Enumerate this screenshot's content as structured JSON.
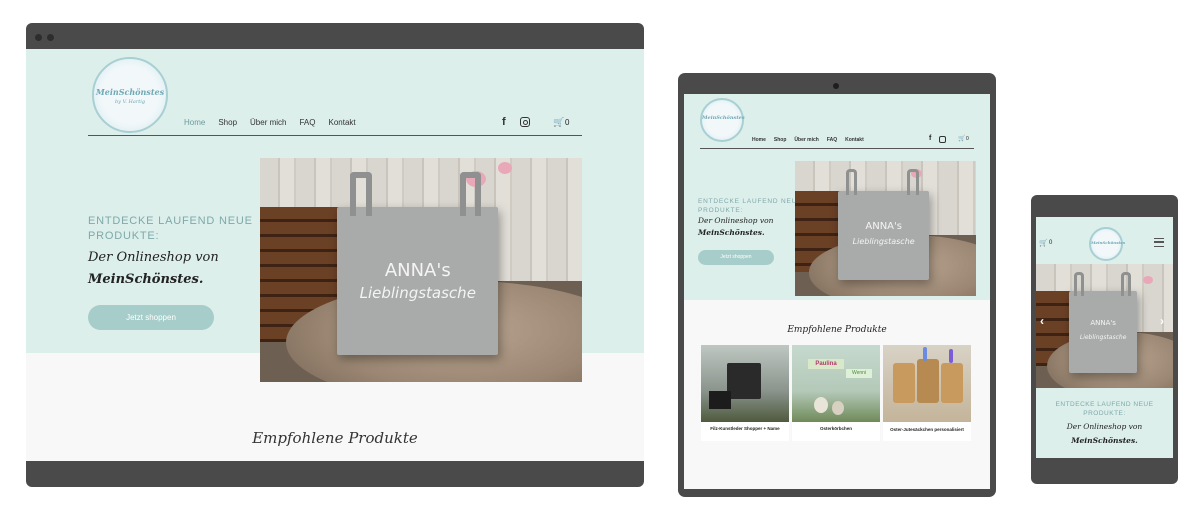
{
  "brand": {
    "logo_main": "MeinSchönstes",
    "logo_sub": "by V. Hartig"
  },
  "nav": {
    "items": [
      "Home",
      "Shop",
      "Über mich",
      "FAQ",
      "Kontakt"
    ],
    "cart_count": "0"
  },
  "hero": {
    "headline_line1": "ENTDECKE LAUFEND NEUE",
    "headline_line2": "PRODUKTE:",
    "sub_line1": "Der Onlineshop von",
    "sub_line2": "MeinSchönstes.",
    "button": "Jetzt shoppen"
  },
  "bag_text": {
    "name": "ANNA's",
    "label": "Lieblingstasche"
  },
  "featured": {
    "title": "Empfohlene Produkte",
    "products": [
      {
        "name": "Filz-Kunstleder Shopper + Name"
      },
      {
        "name": "Osterkörbchen"
      },
      {
        "name": "Oster-Jutesäckchen personalisiert"
      }
    ]
  },
  "product_images": {
    "osterkoerbchen_label_1": "Paulina",
    "osterkoerbchen_label_2": "Wenni"
  },
  "icons": [
    "facebook-icon",
    "instagram-icon",
    "cart-icon",
    "hamburger-icon",
    "chevron-left-icon",
    "chevron-right-icon"
  ],
  "colors": {
    "mint_bg": "#dcefeb",
    "button": "#a6cdc9",
    "teal_text": "#7fa8ab",
    "frame": "#4a4a4a"
  }
}
